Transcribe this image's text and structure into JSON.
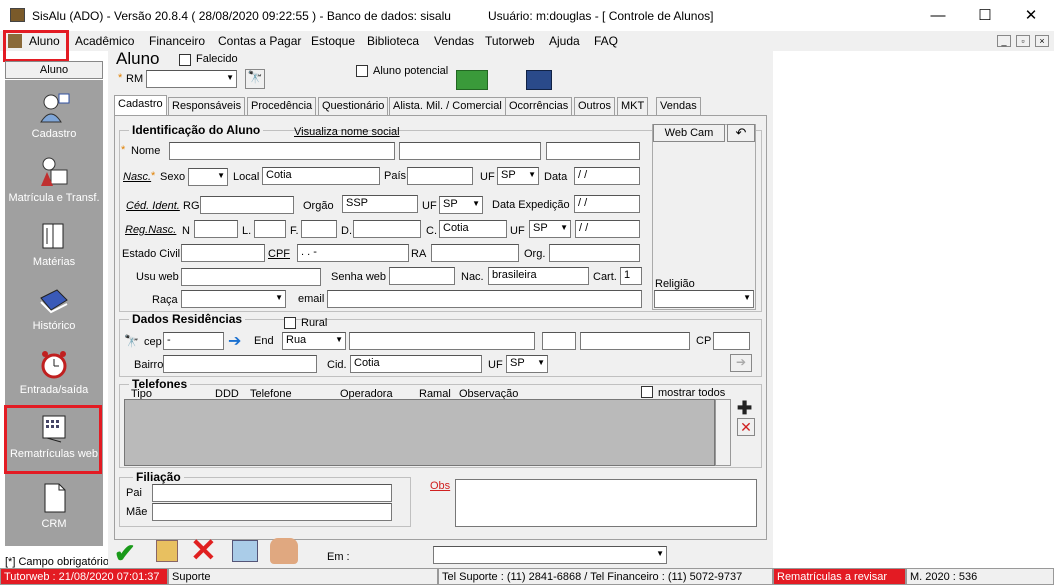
{
  "window": {
    "title": "SisAlu (ADO) - Versão 20.8.4 ( 28/08/2020 09:22:55 ) - Banco de dados: sisalu",
    "user": "Usuário: m:douglas - [ Controle de Alunos]",
    "min": "—",
    "max": "☐",
    "close": "✕"
  },
  "menu": [
    "Aluno",
    "Acadêmico",
    "Financeiro",
    "Contas a Pagar",
    "Estoque",
    "Biblioteca",
    "Vendas",
    "Tutorweb",
    "Ajuda",
    "FAQ"
  ],
  "mdi": [
    "_",
    "▫",
    "×"
  ],
  "sidebar": {
    "header": "Aluno",
    "items": [
      "Cadastro",
      "Matrícula e Transf.",
      "Matérias",
      "Histórico",
      "Entrada/saída",
      "Rematrículas web",
      "CRM"
    ],
    "footer": "[*] Campo obrigatório"
  },
  "form": {
    "title": "Aluno",
    "falecido": "Falecido",
    "rm_label": "RM",
    "aluno_potencial": "Aluno potencial",
    "tabs": [
      "Cadastro",
      "Responsáveis",
      "Procedência",
      "Questionário",
      "Alista. Mil. / Comercial",
      "Ocorrências",
      "Outros",
      "MKT",
      "Vendas"
    ],
    "ident_title": "Identificação do Aluno",
    "visualiza": "Visualiza nome social",
    "webcam": "Web Cam",
    "nome": "Nome",
    "nasc": "Nasc.",
    "sexo": "Sexo",
    "local": "Local",
    "local_val": "Cotia",
    "pais": "País",
    "uf": "UF",
    "uf_val": "SP",
    "data": "Data",
    "date_val": " / /",
    "ced": "Céd. Ident.",
    "rg": "RG",
    "orgao": "Orgão",
    "orgao_val": "SSP",
    "data_exp": "Data Expedição",
    "regnasc": "Reg.Nasc.",
    "n": "N",
    "l": "L.",
    "f": "F.",
    "d": "D.",
    "c": "C.",
    "c_val": "Cotia",
    "estado_civil": "Estado Civil",
    "cpf": "CPF",
    "cpf_val": " .  .  -",
    "ra": "RA",
    "org": "Org.",
    "usu_web": "Usu web",
    "senha_web": "Senha web",
    "nac": "Nac.",
    "nac_val": "brasileira",
    "cart": "Cart.",
    "cart_val": "1",
    "religiao": "Religião",
    "raca": "Raça",
    "email": "email",
    "res_title": "Dados Residências",
    "rural": "Rural",
    "cep": "cep",
    "cep_val": " -",
    "end": "End",
    "end_val": "Rua",
    "cp": "CP",
    "bairro": "Bairro",
    "cid": "Cid.",
    "cid_val": "Cotia",
    "tel_title": "Telefones",
    "mostrar": "mostrar todos",
    "tel_cols": [
      "Tipo",
      "DDD",
      "Telefone",
      "Operadora",
      "Ramal",
      "Observação"
    ],
    "fil_title": "Filiação",
    "pai": "Pai",
    "mae": "Mãe",
    "obs": "Obs",
    "em": "Em :"
  },
  "status": {
    "tutor": "Tutorweb : 21/08/2020 07:01:37",
    "suporte": "Suporte",
    "tel": "Tel Suporte : (11) 2841-6868 / Tel Financeiro : (11) 5072-9737",
    "remat": "Rematrículas a revisar",
    "m": "M. 2020 : 536"
  },
  "colors": {
    "highlight": "#e31b23",
    "sidebar": "#a0a0a0",
    "status_red": "#e31b23"
  }
}
